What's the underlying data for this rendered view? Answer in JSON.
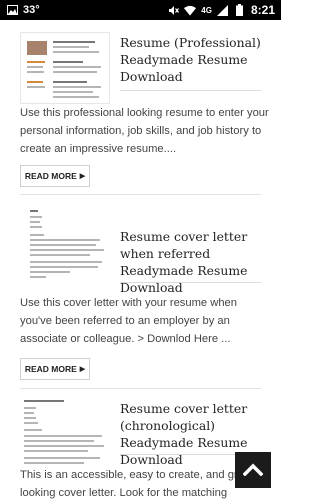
{
  "status_bar": {
    "temperature": "33°",
    "network": "4G",
    "time": "8:21"
  },
  "articles": [
    {
      "title": "Resume (Professional) Readymade Resume Download",
      "description": "Use this professional looking resume to enter your personal information, job skills, and job history to create an impressive resume....",
      "button_label": "READ MORE"
    },
    {
      "title": "Resume cover letter when referred Readymade Resume Download",
      "description": "Use this cover letter with your resume when you've been referred to an employer by an associate or colleague. >   Downlod Here ...",
      "button_label": "READ MORE"
    },
    {
      "title": "Resume cover letter (chronological) Readymade Resume Download",
      "description": "This is an accessible, easy to create, and great looking cover letter. Look for the matching resume. >   Downlod Here",
      "button_label": ""
    }
  ],
  "icons": {
    "scroll_top": "chevron-up-icon"
  }
}
